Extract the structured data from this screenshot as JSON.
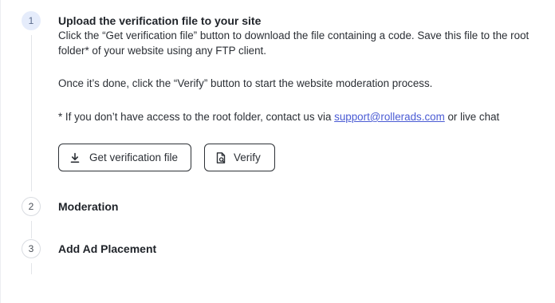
{
  "steps": [
    {
      "number": "1",
      "title": "Upload the verification file to your site",
      "description": "Click the “Get verification file” button to download the file containing a code. Save this file to the root folder* of your website using any FTP client.",
      "instruction": "Once it’s done, click the “Verify” button to start the website moderation process.",
      "note_prefix": "* If you don’t have access to the root folder, contact us via ",
      "note_link": "support@rollerads.com",
      "note_suffix": " or live chat",
      "buttons": {
        "download_label": "Get verification file",
        "download_icon": "download-icon",
        "verify_label": "Verify",
        "verify_icon": "document-search-icon"
      }
    },
    {
      "number": "2",
      "title": "Moderation"
    },
    {
      "number": "3",
      "title": "Add Ad Placement"
    }
  ],
  "colors": {
    "active_step_bg": "#e5ecfb",
    "link": "#4a5bd4",
    "button_border": "#2d3136"
  }
}
